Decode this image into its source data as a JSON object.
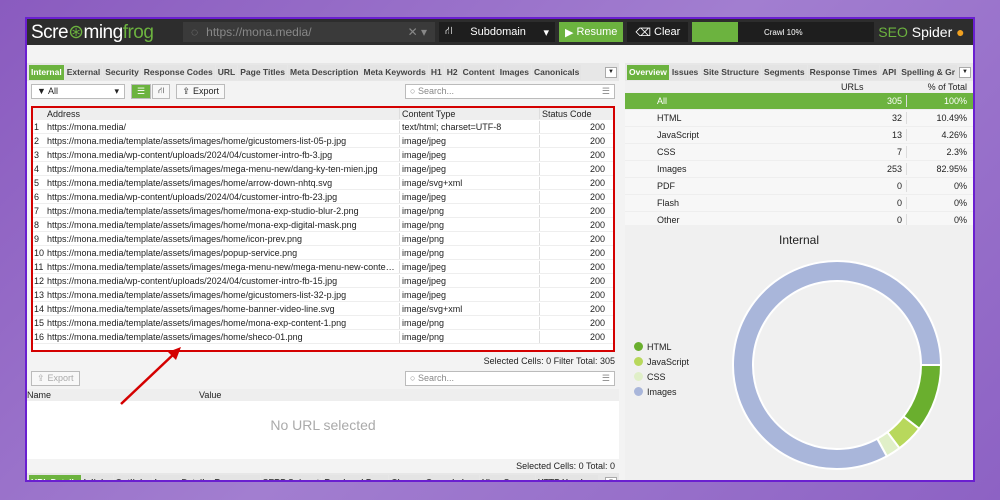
{
  "topbar": {
    "logo_a": "Scre",
    "logo_mid": "ming",
    "logo_b": "frog",
    "url": "https://mona.media/",
    "mode": "Subdomain",
    "resume": "Resume",
    "clear": "Clear",
    "crawl": "Crawl 10%",
    "crawl_progress": 10,
    "brand_a": "SEO",
    "brand_b": "Spider"
  },
  "tabs": [
    "Internal",
    "External",
    "Security",
    "Response Codes",
    "URL",
    "Page Titles",
    "Meta Description",
    "Meta Keywords",
    "H1",
    "H2",
    "Content",
    "Images",
    "Canonicals"
  ],
  "toolbar": {
    "filter": "All",
    "export": "Export",
    "search_placeholder": "Search..."
  },
  "table": {
    "headers": [
      "Address",
      "Content Type",
      "Status Code"
    ],
    "rows": [
      [
        "1",
        "https://mona.media/",
        "text/html; charset=UTF-8",
        "200"
      ],
      [
        "2",
        "https://mona.media/template/assets/images/home/gicustomers-list-05-p.jpg",
        "image/jpeg",
        "200"
      ],
      [
        "3",
        "https://mona.media/wp-content/uploads/2024/04/customer-intro-fb-3.jpg",
        "image/jpeg",
        "200"
      ],
      [
        "4",
        "https://mona.media/template/assets/images/mega-menu-new/dang-ky-ten-mien.jpg",
        "image/jpeg",
        "200"
      ],
      [
        "5",
        "https://mona.media/template/assets/images/home/arrow-down-nhtq.svg",
        "image/svg+xml",
        "200"
      ],
      [
        "6",
        "https://mona.media/wp-content/uploads/2024/04/customer-intro-fb-23.jpg",
        "image/jpeg",
        "200"
      ],
      [
        "7",
        "https://mona.media/template/assets/images/home/mona-exp-studio-blur-2.png",
        "image/png",
        "200"
      ],
      [
        "8",
        "https://mona.media/template/assets/images/home/mona-exp-digital-mask.png",
        "image/png",
        "200"
      ],
      [
        "9",
        "https://mona.media/template/assets/images/home/icon-prev.png",
        "image/png",
        "200"
      ],
      [
        "10",
        "https://mona.media/template/assets/images/popup-service.png",
        "image/png",
        "200"
      ],
      [
        "11",
        "https://mona.media/template/assets/images/mega-menu-new/mega-menu-new-content-...",
        "image/jpeg",
        "200"
      ],
      [
        "12",
        "https://mona.media/wp-content/uploads/2024/04/customer-intro-fb-15.jpg",
        "image/jpeg",
        "200"
      ],
      [
        "13",
        "https://mona.media/template/assets/images/home/gicustomers-list-32-p.jpg",
        "image/jpeg",
        "200"
      ],
      [
        "14",
        "https://mona.media/template/assets/images/home-banner-video-line.svg",
        "image/svg+xml",
        "200"
      ],
      [
        "15",
        "https://mona.media/template/assets/images/home/mona-exp-content-1.png",
        "image/png",
        "200"
      ],
      [
        "16",
        "https://mona.media/template/assets/images/home/sheco-01.png",
        "image/png",
        "200"
      ]
    ],
    "status": "Selected Cells:  0  Filter Total:  305"
  },
  "lower": {
    "export": "Export",
    "search_placeholder": "Search...",
    "headers": [
      "Name",
      "Value"
    ],
    "empty": "No URL selected",
    "status": "Selected Cells:  0  Total:  0",
    "tabs": [
      "URL Details",
      "Inlinks",
      "Outlinks",
      "Image Details",
      "Resources",
      "SERP Snippet",
      "Rendered Page",
      "Chrome Console Log",
      "View Source",
      "HTTP Headers"
    ]
  },
  "right": {
    "tabs": [
      "Overview",
      "Issues",
      "Site Structure",
      "Segments",
      "Response Times",
      "API",
      "Spelling & Gr"
    ],
    "headers": [
      "URLs",
      "% of Total"
    ],
    "rows": [
      [
        "All",
        "305",
        "100%"
      ],
      [
        "HTML",
        "32",
        "10.49%"
      ],
      [
        "JavaScript",
        "13",
        "4.26%"
      ],
      [
        "CSS",
        "7",
        "2.3%"
      ],
      [
        "Images",
        "253",
        "82.95%"
      ],
      [
        "PDF",
        "0",
        "0%"
      ],
      [
        "Flash",
        "0",
        "0%"
      ],
      [
        "Other",
        "0",
        "0%"
      ]
    ]
  },
  "chart_data": {
    "type": "pie",
    "donut": true,
    "title": "Internal",
    "legend_position": "left",
    "series": [
      {
        "name": "HTML",
        "value": 32,
        "color": "#6aaf2e"
      },
      {
        "name": "JavaScript",
        "value": 13,
        "color": "#b8d85c"
      },
      {
        "name": "CSS",
        "value": 7,
        "color": "#e0efc8"
      },
      {
        "name": "Images",
        "value": 253,
        "color": "#a9b6da"
      }
    ]
  }
}
